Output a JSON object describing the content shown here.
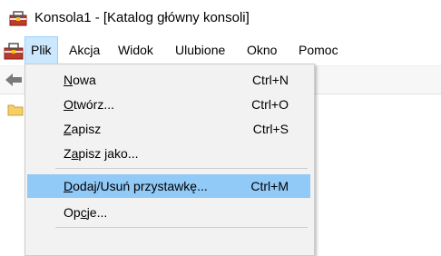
{
  "window": {
    "title": "Konsola1 - [Katalog główny konsoli]",
    "app_icon": "mmc-toolbox-icon"
  },
  "menubar": {
    "items": [
      {
        "label": "Plik"
      },
      {
        "label": "Akcja"
      },
      {
        "label": "Widok"
      },
      {
        "label": "Ulubione"
      },
      {
        "label": "Okno"
      },
      {
        "label": "Pomoc"
      }
    ]
  },
  "toolbar": {
    "back_icon": "back-arrow-icon"
  },
  "content": {
    "folder_icon": "folder-icon",
    "partial_text": "a"
  },
  "file_menu": {
    "items": [
      {
        "underline": "N",
        "rest": "owa",
        "shortcut": "Ctrl+N"
      },
      {
        "underline": "O",
        "rest": "twórz...",
        "shortcut": "Ctrl+O"
      },
      {
        "underline": "Z",
        "rest": "apisz",
        "shortcut": "Ctrl+S"
      },
      {
        "pre": "Z",
        "underline": "a",
        "rest": "pisz jako...",
        "shortcut": ""
      },
      {
        "underline": "D",
        "rest": "odaj/Usuń przystawkę...",
        "shortcut": "Ctrl+M"
      },
      {
        "pre": "Op",
        "underline": "c",
        "rest": "je...",
        "shortcut": ""
      }
    ],
    "highlight_color": "#91c9f7"
  }
}
